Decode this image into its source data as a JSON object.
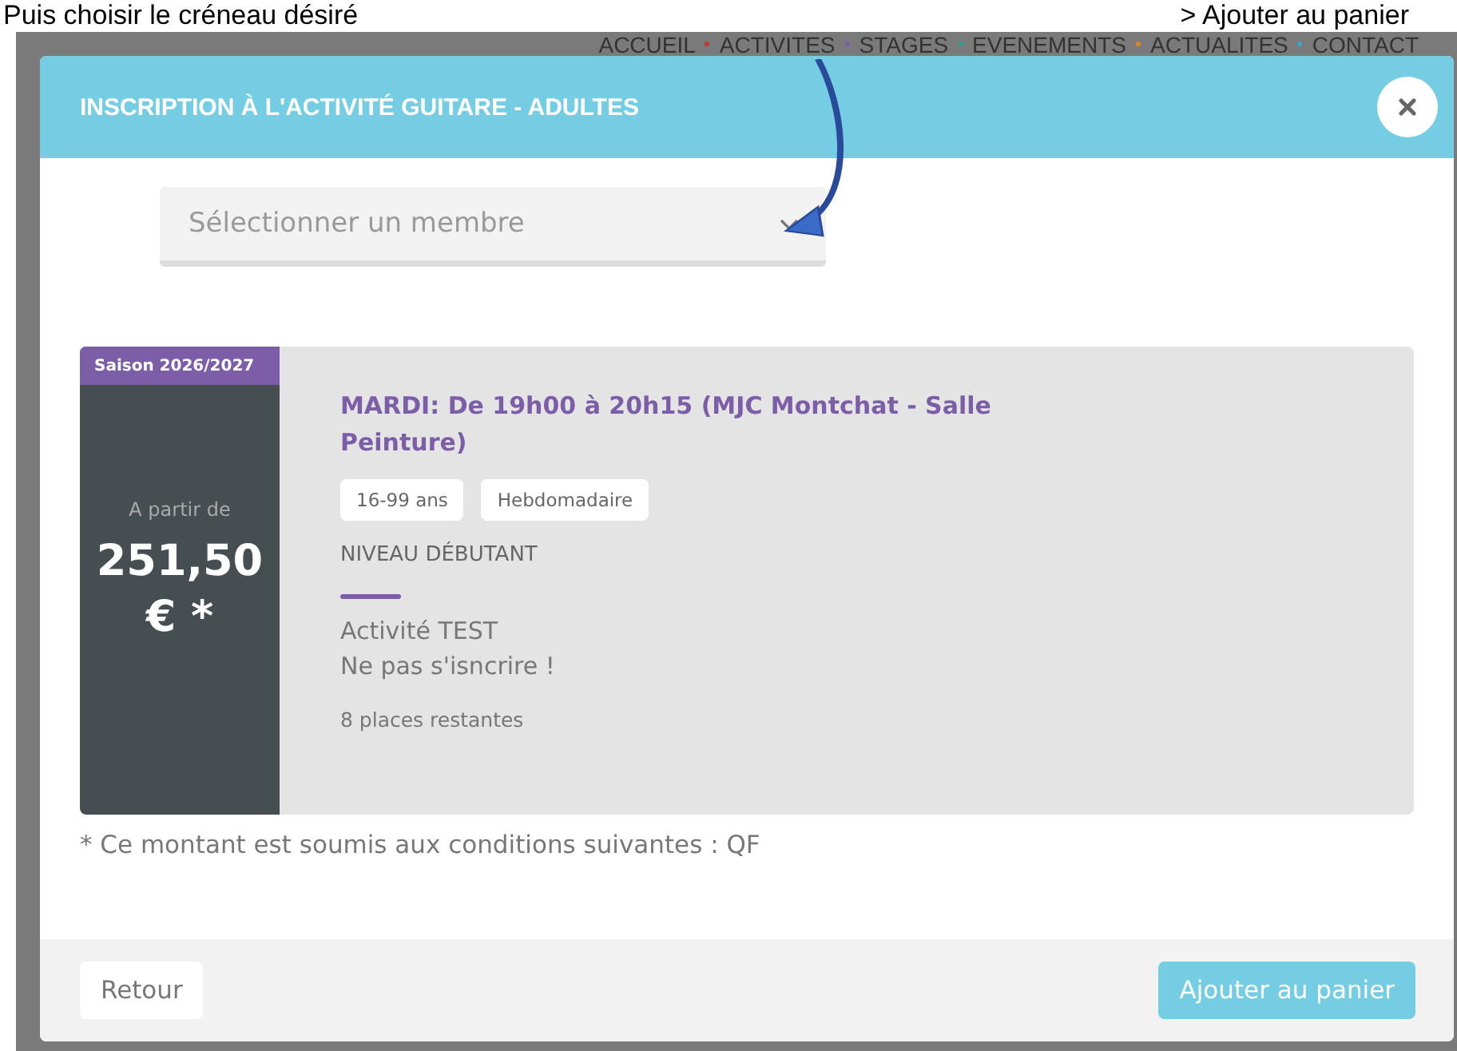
{
  "captions": [
    "Puis choisir le créneau désiré",
    "> Ajouter au panier"
  ],
  "nav": [
    {
      "label": "ACCUEIL",
      "color": "#c0392b"
    },
    {
      "label": "ACTIVITES",
      "color": "#7b5ea7"
    },
    {
      "label": "STAGES",
      "color": "#2a9d8f"
    },
    {
      "label": "EVENEMENTS",
      "color": "#e08a1e"
    },
    {
      "label": "ACTUALITES",
      "color": "#3aa9c9"
    },
    {
      "label": "CONTACT"
    }
  ],
  "modal": {
    "title": "INSCRIPTION À L'ACTIVITÉ GUITARE - ADULTES",
    "member_select": {
      "placeholder": "Sélectionner un membre"
    },
    "slot": {
      "season": "Saison 2026/2027",
      "price_prefix": "A partir de",
      "price": "251,50 € *",
      "title": "MARDI:  De 19h00 à 20h15  (MJC Montchat - Salle Peinture)",
      "tags": [
        "16-99 ans",
        "Hebdomadaire"
      ],
      "level": "NIVEAU DÉBUTANT",
      "description": [
        "Activité TEST",
        "Ne pas s'isncrire !"
      ],
      "places": "8 places restantes"
    },
    "footnote": "* Ce montant est soumis aux conditions suivantes : QF",
    "buttons": {
      "back": "Retour",
      "add": "Ajouter au panier"
    }
  }
}
